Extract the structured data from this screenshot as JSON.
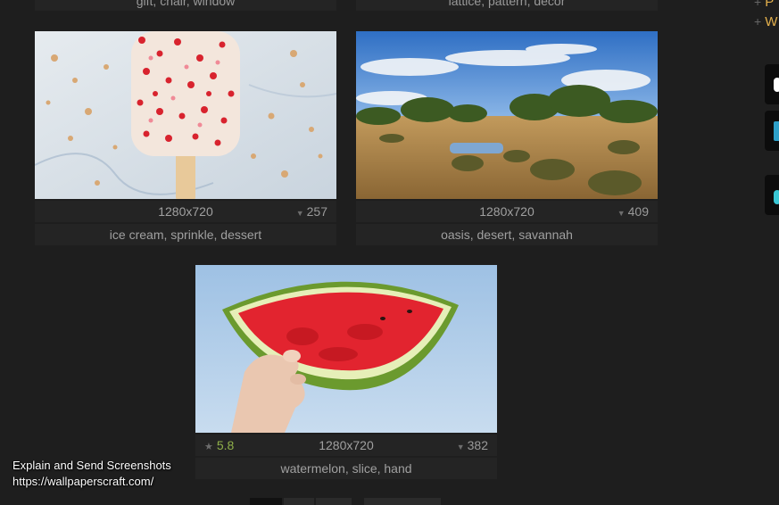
{
  "top_cards": [
    {
      "tags": "gift, chair, window"
    },
    {
      "tags": "lattice, pattern, decor"
    }
  ],
  "cards": [
    {
      "resolution": "1280x720",
      "downloads": "257",
      "tags": "ice cream, sprinkle, dessert"
    },
    {
      "resolution": "1280x720",
      "downloads": "409",
      "tags": "oasis, desert, savannah"
    },
    {
      "rating": "5.8",
      "resolution": "1280x720",
      "downloads": "382",
      "tags": "watermelon, slice, hand"
    }
  ],
  "sidebar": {
    "links": [
      "P",
      "W"
    ]
  },
  "watermark": {
    "line1": "Explain and Send Screenshots",
    "line2": "https://wallpaperscraft.com/"
  },
  "icons": {
    "download": "download-icon",
    "star": "star-icon",
    "plus": "plus-icon"
  },
  "colors": {
    "accent": "#e3b04c",
    "rating": "#8fb04a",
    "background": "#1e1e1e",
    "panel": "#242424"
  }
}
